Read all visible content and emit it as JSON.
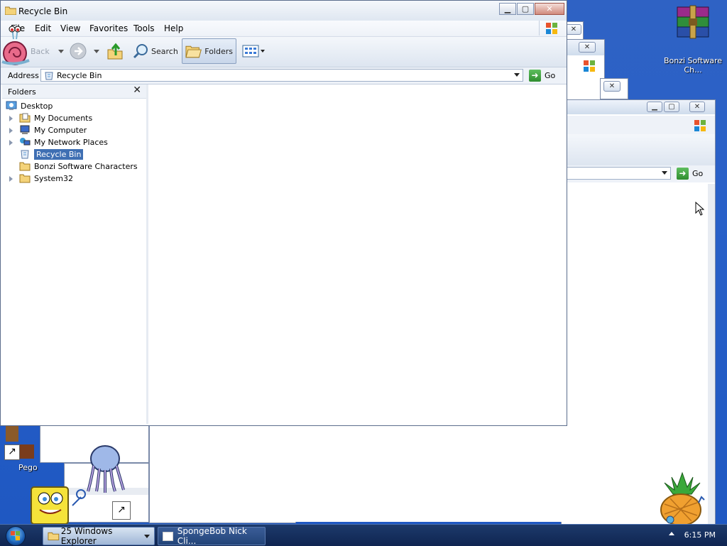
{
  "window": {
    "title": "Recycle Bin",
    "min_label": "▁",
    "max_label": "▢",
    "close_label": "✕"
  },
  "menu": [
    "File",
    "Edit",
    "View",
    "Favorites",
    "Tools",
    "Help"
  ],
  "toolbar": {
    "back_label": "Back",
    "search_label": "Search",
    "folders_label": "Folders"
  },
  "address": {
    "label": "Address",
    "value": "Recycle Bin",
    "go_label": "Go"
  },
  "folders_pane": {
    "title": "Folders",
    "close_label": "✕",
    "items": [
      {
        "label": "Desktop",
        "icon": "desktop-icon"
      },
      {
        "label": "My Documents",
        "icon": "documents-icon"
      },
      {
        "label": "My Computer",
        "icon": "computer-icon"
      },
      {
        "label": "My Network Places",
        "icon": "network-icon"
      },
      {
        "label": "Recycle Bin",
        "icon": "recycle-bin-icon",
        "selected": true
      },
      {
        "label": "Bonzi Software Characters",
        "icon": "folder-icon"
      },
      {
        "label": "System32",
        "icon": "folder-icon"
      }
    ]
  },
  "background_window": {
    "go_label": "Go"
  },
  "desktop": {
    "icons": [
      {
        "label": "Bonzi Software Ch...",
        "icon": "winrar-icon"
      },
      {
        "label": "Pego",
        "icon": "shortcut-icon"
      }
    ]
  },
  "taskbar": {
    "tasks": [
      {
        "label": "25 Windows Explorer",
        "active": true
      },
      {
        "label": "SpongeBob Nick Cli...",
        "active": false
      }
    ],
    "clock": "6:15 PM"
  },
  "colors": {
    "selection": "#3f6fb3",
    "desktop": "#2860c8",
    "taskbar": "#0f2551"
  }
}
